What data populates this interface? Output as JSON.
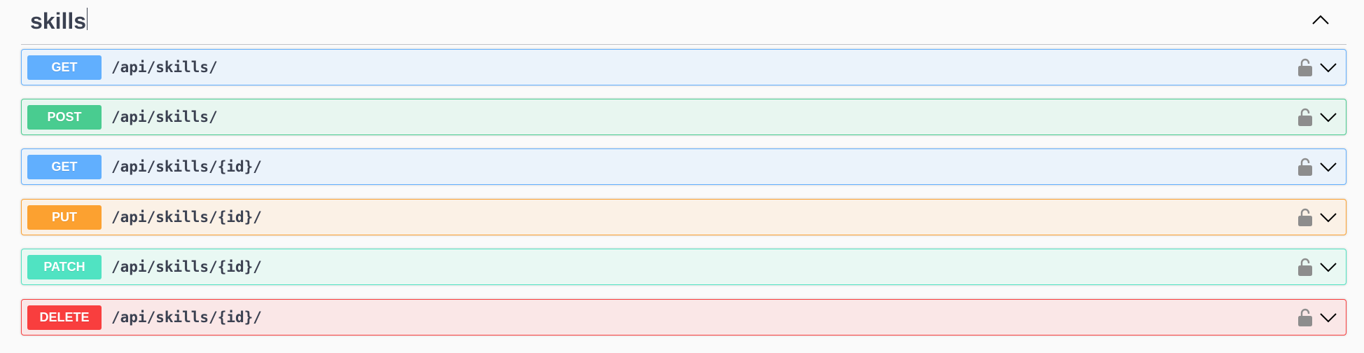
{
  "section": {
    "title": "skills",
    "collapse_icon": "chevron-up-icon"
  },
  "operations": [
    {
      "method": "GET",
      "path": "/api/skills/",
      "bg": "#ebf3fb",
      "border": "#61affe",
      "badge": "#61affe",
      "lock_icon": "unlocked-lock-icon",
      "expand_icon": "chevron-down-icon"
    },
    {
      "method": "POST",
      "path": "/api/skills/",
      "bg": "#e8f6f0",
      "border": "#49cc90",
      "badge": "#49cc90",
      "lock_icon": "unlocked-lock-icon",
      "expand_icon": "chevron-down-icon"
    },
    {
      "method": "GET",
      "path": "/api/skills/{id}/",
      "bg": "#ebf3fb",
      "border": "#61affe",
      "badge": "#61affe",
      "lock_icon": "unlocked-lock-icon",
      "expand_icon": "chevron-down-icon"
    },
    {
      "method": "PUT",
      "path": "/api/skills/{id}/",
      "bg": "#fbf1e6",
      "border": "#fca130",
      "badge": "#fca130",
      "lock_icon": "unlocked-lock-icon",
      "expand_icon": "chevron-down-icon"
    },
    {
      "method": "PATCH",
      "path": "/api/skills/{id}/",
      "bg": "#e9f8f3",
      "border": "#50e3c2",
      "badge": "#50e3c2",
      "lock_icon": "unlocked-lock-icon",
      "expand_icon": "chevron-down-icon"
    },
    {
      "method": "DELETE",
      "path": "/api/skills/{id}/",
      "bg": "#fae7e7",
      "border": "#f93e3e",
      "badge": "#f93e3e",
      "lock_icon": "unlocked-lock-icon",
      "expand_icon": "chevron-down-icon"
    }
  ]
}
